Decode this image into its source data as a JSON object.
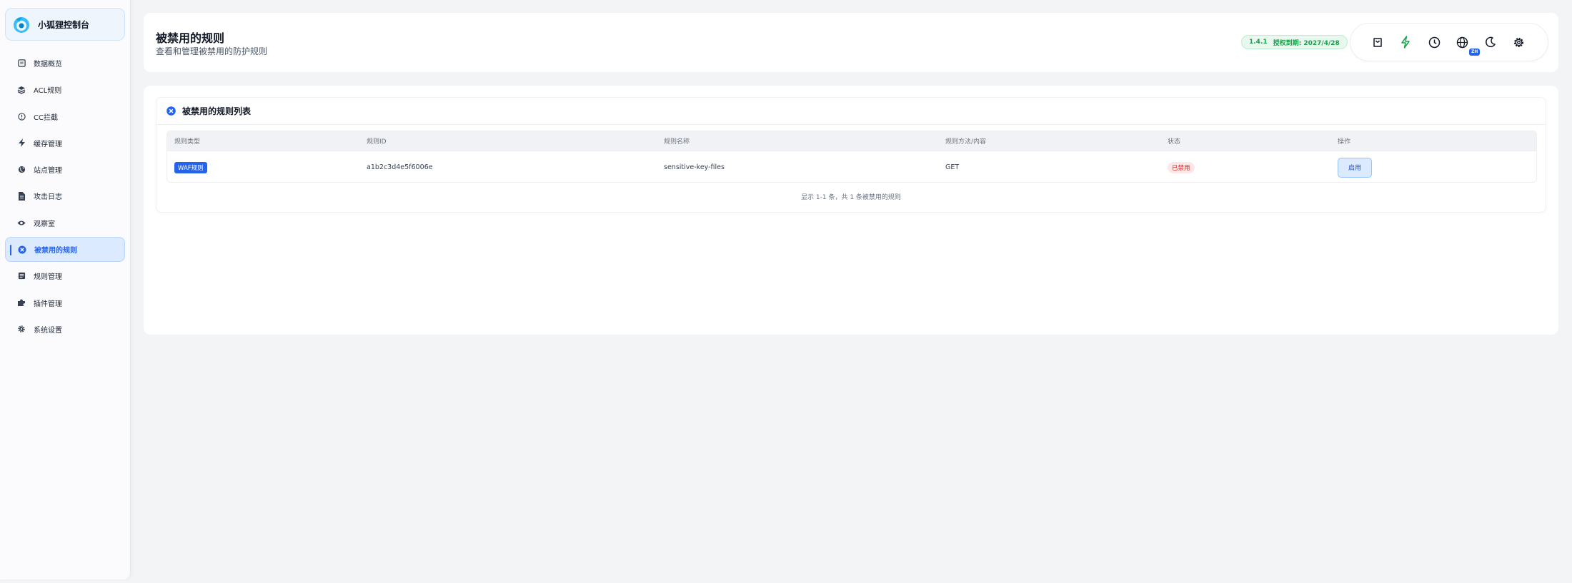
{
  "app": {
    "title": "小狐狸控制台"
  },
  "sidebar": {
    "items": [
      {
        "label": "数据概览",
        "icon": "dashboard-icon"
      },
      {
        "label": "ACL规则",
        "icon": "layers-icon"
      },
      {
        "label": "CC拦截",
        "icon": "alert-circle-icon"
      },
      {
        "label": "缓存管理",
        "icon": "bolt-icon"
      },
      {
        "label": "站点管理",
        "icon": "globe-icon"
      },
      {
        "label": "攻击日志",
        "icon": "file-icon"
      },
      {
        "label": "观察室",
        "icon": "eye-icon"
      },
      {
        "label": "被禁用的规则",
        "icon": "ban-icon",
        "active": true
      },
      {
        "label": "规则管理",
        "icon": "rules-icon"
      },
      {
        "label": "插件管理",
        "icon": "puzzle-icon"
      },
      {
        "label": "系统设置",
        "icon": "gear-icon"
      }
    ]
  },
  "header": {
    "title": "被禁用的规则",
    "subtitle": "查看和管理被禁用的防护规则",
    "version": "1.4.1",
    "license": "授权到期: 2027/4/28",
    "lang_badge": "ZH",
    "toolbar_icons": [
      "shopping-bag-icon",
      "lightning-icon",
      "clock-icon",
      "globe-icon",
      "moon-icon",
      "gear-icon"
    ]
  },
  "list": {
    "title": "被禁用的规则列表",
    "columns": [
      "规则类型",
      "规则ID",
      "规则名称",
      "规则方法/内容",
      "状态",
      "操作"
    ],
    "rows": [
      {
        "type": "WAF规则",
        "id": "a1b2c3d4e5f6006e",
        "name": "sensitive-key-files",
        "method": "GET",
        "status": "已禁用",
        "action": "启用"
      }
    ],
    "footer": "显示 1-1 条，共 1 条被禁用的规则"
  },
  "colors": {
    "accent": "#2563eb",
    "success": "#16a34a",
    "danger": "#dc2626"
  }
}
